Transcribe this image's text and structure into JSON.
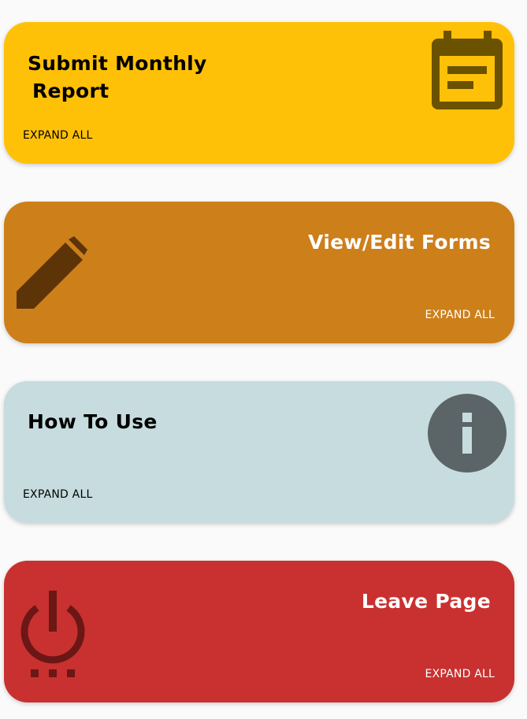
{
  "cards": [
    {
      "title_line1": "Submit Monthly",
      "title_line2": "Report",
      "expand_label": "EXPAND ALL",
      "icon": "calendar-icon",
      "background": "#ffc107",
      "text_color": "#000000",
      "icon_color": "#6b5200"
    },
    {
      "title": "View/Edit Forms",
      "expand_label": "EXPAND ALL",
      "icon": "pencil-icon",
      "background": "#cd7f1a",
      "text_color": "#ffffff",
      "icon_color": "#5c3408"
    },
    {
      "title": "How To Use",
      "expand_label": "EXPAND ALL",
      "icon": "info-icon",
      "background": "#c6dcdf",
      "text_color": "#000000",
      "icon_color": "#5b6466"
    },
    {
      "title": "Leave Page",
      "expand_label": "EXPAND ALL",
      "icon": "power-icon",
      "background": "#c8312f",
      "text_color": "#ffffff",
      "icon_color": "#6b1716"
    }
  ]
}
